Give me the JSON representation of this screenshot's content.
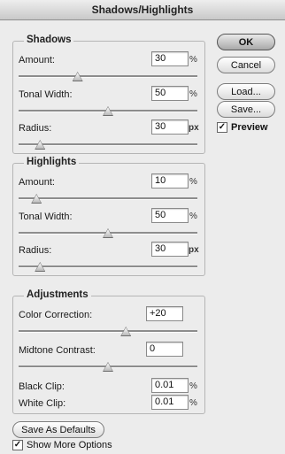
{
  "window": {
    "title": "Shadows/Highlights"
  },
  "shadows": {
    "title": "Shadows",
    "amount": {
      "label": "Amount:",
      "value": "30",
      "unit": "%",
      "slider_fraction": 0.33
    },
    "tonal_width": {
      "label": "Tonal Width:",
      "value": "50",
      "unit": "%",
      "slider_fraction": 0.5
    },
    "radius": {
      "label": "Radius:",
      "value": "30",
      "unit": "px",
      "slider_fraction": 0.12
    }
  },
  "highlights": {
    "title": "Highlights",
    "amount": {
      "label": "Amount:",
      "value": "10",
      "unit": "%",
      "slider_fraction": 0.1
    },
    "tonal_width": {
      "label": "Tonal Width:",
      "value": "50",
      "unit": "%",
      "slider_fraction": 0.5
    },
    "radius": {
      "label": "Radius:",
      "value": "30",
      "unit": "px",
      "slider_fraction": 0.12
    }
  },
  "adjustments": {
    "title": "Adjustments",
    "color_correction": {
      "label": "Color Correction:",
      "value": "+20",
      "slider_fraction": 0.6
    },
    "midtone_contrast": {
      "label": "Midtone Contrast:",
      "value": "0",
      "slider_fraction": 0.5
    },
    "black_clip": {
      "label": "Black Clip:",
      "value": "0.01",
      "unit": "%"
    },
    "white_clip": {
      "label": "White Clip:",
      "value": "0.01",
      "unit": "%"
    }
  },
  "buttons": {
    "ok": "OK",
    "cancel": "Cancel",
    "load": "Load...",
    "save": "Save...",
    "save_defaults": "Save As Defaults"
  },
  "checkboxes": {
    "preview": {
      "label": "Preview",
      "checked": true
    },
    "show_more": {
      "label": "Show More Options",
      "checked": true
    }
  }
}
